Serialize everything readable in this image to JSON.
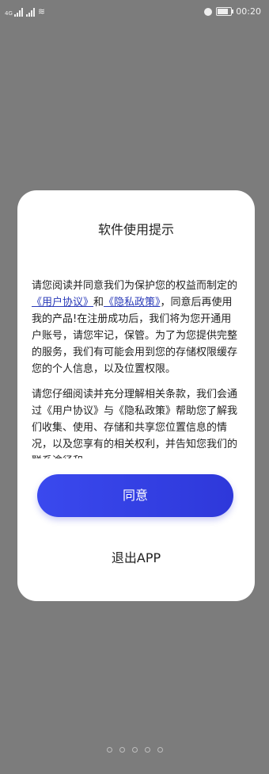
{
  "status_bar": {
    "network_tag": "4G",
    "wifi_icon": "wifi-icon",
    "alarm_icon": "alarm-icon",
    "battery_icon": "battery-icon",
    "battery_level": 0.8,
    "time": "00:20"
  },
  "dialog": {
    "title": "软件使用提示",
    "paragraph1": {
      "t1": "请您阅读并同意我们为保护您的权益而制定的",
      "link_user": "《用户协议》",
      "t2": "和",
      "link_privacy": "《隐私政策》",
      "t3": "，同意后再使用我的产品!在注册成功后，我们将为您开通用户账号，请您牢记，保管。为了为您提供完整的服务，我们有可能会用到您的存储权限缓存您的个人信息，以及位置权限。"
    },
    "paragraph2": "请您仔细阅读并充分理解相关条款，我们会通过《用户协议》与《隐私政策》帮助您了解我们收集、使用、存储和共享您位置信息的情况，以及您享有的相关权利，并告知您我们的联系途径和",
    "agree_label": "同意",
    "exit_label": "退出APP"
  },
  "page_indicator": {
    "count": 5
  }
}
